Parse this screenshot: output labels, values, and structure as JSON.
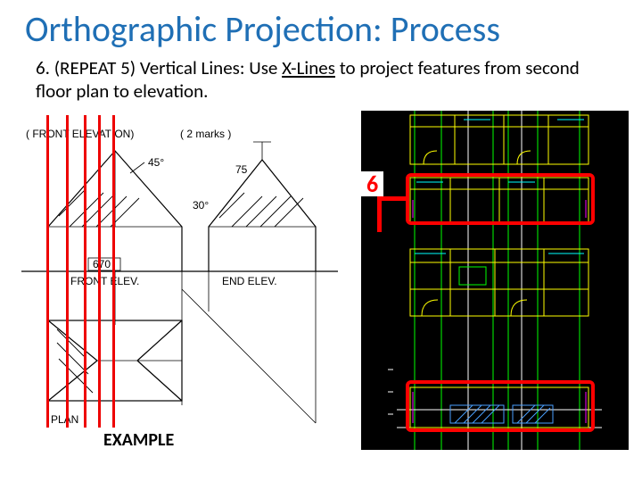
{
  "title": "Orthographic Projection: Process",
  "subtitle_prefix": "6. (REPEAT 5) Vertical Lines: Use ",
  "subtitle_em": "X-Lines",
  "subtitle_suffix": " to project features from second floor plan to elevation.",
  "example_label": "EXAMPLE",
  "step_label": "6",
  "left": {
    "front_elev_text": "( FRONT ELEVATION)",
    "marks_text": "( 2 marks )",
    "angle_45": "45°",
    "angle_30": "30°",
    "dim_75": "75",
    "label_670": "670",
    "front_elev": "FRONT ELEV.",
    "end_elev": "END ELEV.",
    "plan": "PLAN"
  }
}
